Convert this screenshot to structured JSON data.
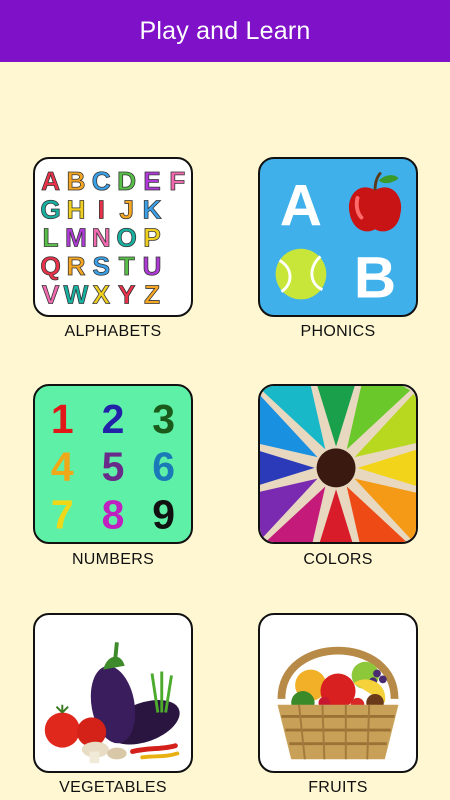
{
  "app": {
    "title": "Play and Learn"
  },
  "colors": {
    "appbar": "#7f12c9",
    "background": "#fef7d2"
  },
  "categories": [
    {
      "id": "alphabets",
      "label": "ALPHABETS",
      "icon": "alphabet-blocks-icon"
    },
    {
      "id": "phonics",
      "label": "PHONICS",
      "icon": "phonics-icon"
    },
    {
      "id": "numbers",
      "label": "NUMBERS",
      "icon": "numbers-icon"
    },
    {
      "id": "colors",
      "label": "COLORS",
      "icon": "color-pencils-icon"
    },
    {
      "id": "vegetables",
      "label": "VEGETABLES",
      "icon": "vegetables-icon"
    },
    {
      "id": "fruits",
      "label": "FRUITS",
      "icon": "fruit-basket-icon"
    }
  ],
  "alphabet_letters": [
    "A",
    "B",
    "C",
    "D",
    "E",
    "F",
    "G",
    "H",
    "I",
    "J",
    "K",
    "L",
    "M",
    "N",
    "O",
    "P",
    "Q",
    "R",
    "S",
    "T",
    "U",
    "V",
    "W",
    "X",
    "Y",
    "Z"
  ],
  "phonics_letters": [
    "A",
    "B"
  ],
  "number_digits": [
    "1",
    "2",
    "3",
    "4",
    "5",
    "6",
    "7",
    "8",
    "9"
  ]
}
